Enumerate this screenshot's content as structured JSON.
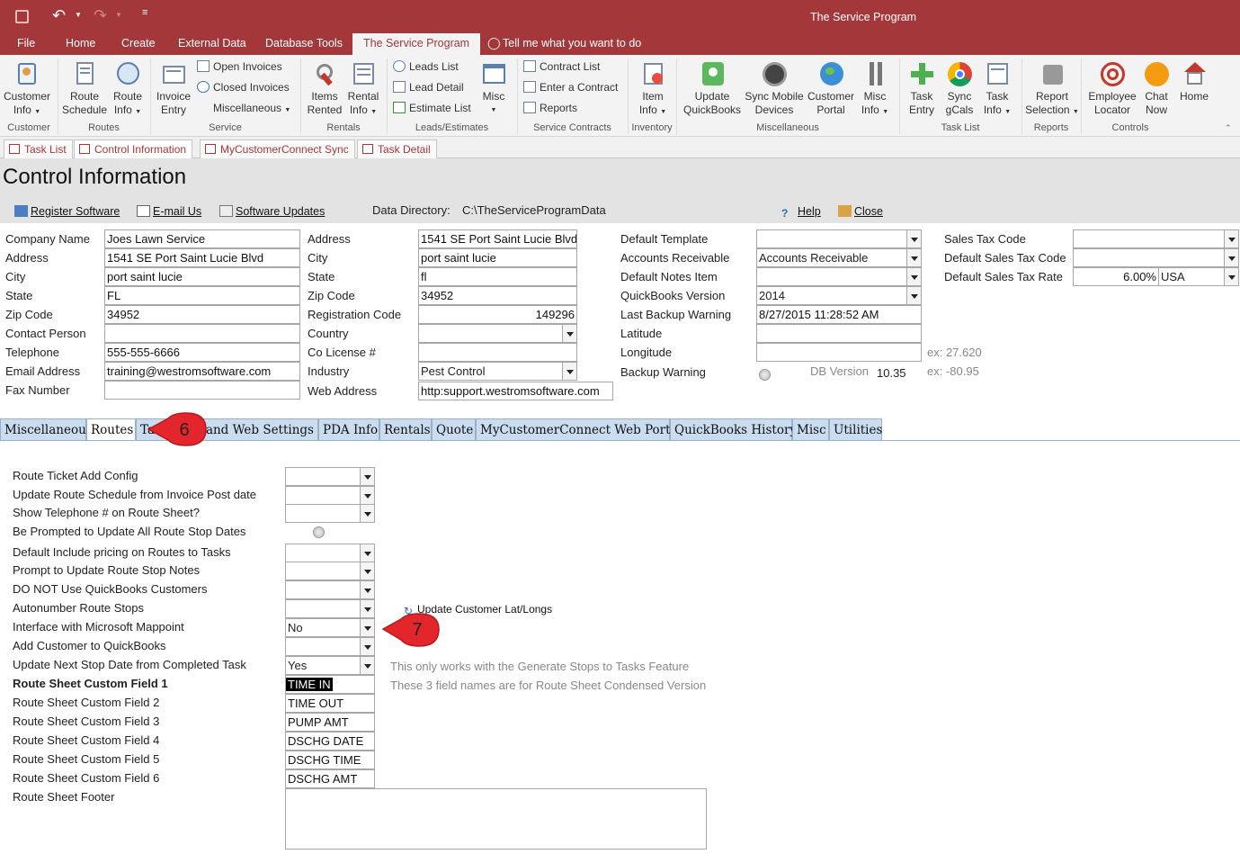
{
  "app": {
    "title": "The Service Program"
  },
  "menu": {
    "file": "File",
    "home": "Home",
    "create": "Create",
    "external": "External Data",
    "dbtools": "Database Tools",
    "service": "The Service Program",
    "tell": "Tell me what you want to do"
  },
  "ribbon": {
    "customer_info": "Customer",
    "customer_info2": "Info",
    "route_schedule": "Route",
    "route_schedule2": "Schedule",
    "route_info": "Route",
    "route_info2": "Info",
    "invoice_entry": "Invoice",
    "invoice_entry2": "Entry",
    "open_invoices": "Open Invoices",
    "closed_invoices": "Closed Invoices",
    "miscellaneous": "Miscellaneous",
    "items_rented": "Items",
    "items_rented2": "Rented",
    "rental_info": "Rental",
    "rental_info2": "Info",
    "leads_list": "Leads List",
    "lead_detail": "Lead Detail",
    "estimate_list": "Estimate List",
    "misc": "Misc",
    "contract_list": "Contract List",
    "enter_contract": "Enter a Contract",
    "reports": "Reports",
    "item_info": "Item",
    "item_info2": "Info",
    "update_qb": "Update",
    "update_qb2": "QuickBooks",
    "sync_mobile": "Sync Mobile",
    "sync_mobile2": "Devices",
    "customer_portal": "Customer",
    "customer_portal2": "Portal",
    "misc_info": "Misc",
    "misc_info2": "Info",
    "task_entry": "Task",
    "task_entry2": "Entry",
    "sync_gcals": "Sync",
    "sync_gcals2": "gCals",
    "task_info": "Task",
    "task_info2": "Info",
    "report_selection": "Report",
    "report_selection2": "Selection",
    "employee_locator": "Employee",
    "employee_locator2": "Locator",
    "chat_now": "Chat",
    "chat_now2": "Now",
    "home": "Home",
    "groups": {
      "customer": "Customer",
      "routes": "Routes",
      "service": "Service",
      "rentals": "Rentals",
      "leads": "Leads/Estimates",
      "contracts": "Service Contracts",
      "inventory": "Inventory",
      "miscellaneous": "Miscellaneous",
      "tasklist": "Task List",
      "reports": "Reports",
      "controls": "Controls"
    }
  },
  "doc_tabs": [
    "Task List",
    "Control Information",
    "MyCustomerConnect Sync",
    "Task Detail"
  ],
  "header": {
    "title": "Control Information",
    "register": "Register Software",
    "email": "E-mail Us",
    "updates": "Software Updates",
    "data_dir_label": "Data Directory:",
    "data_dir": "C:\\TheServiceProgramData",
    "help": "Help",
    "close": "Close"
  },
  "company": {
    "labels": [
      "Company Name",
      "Address",
      "City",
      "State",
      "Zip Code",
      "Contact Person",
      "Telephone",
      "Email Address",
      "Fax Number"
    ],
    "values": [
      "Joes Lawn Service",
      "1541 SE Port Saint Lucie Blvd",
      "port saint lucie",
      "FL",
      "34952",
      "",
      "555-555-6666",
      "training@westromsoftware.com",
      ""
    ]
  },
  "registration": {
    "labels": [
      "Address",
      "City",
      "State",
      "Zip Code",
      "Registration Code",
      "Country",
      "Co License #",
      "Industry",
      "Web Address"
    ],
    "address": "1541 SE Port Saint Lucie Blvd",
    "city": "port saint lucie",
    "state": "fl",
    "zip": "34952",
    "reg_code": "149296",
    "country": "",
    "license": "",
    "industry": "Pest Control",
    "web": "http:support.westromsoftware.com"
  },
  "defaults": {
    "labels": [
      "Default Template",
      "Accounts Receivable",
      "Default Notes Item",
      "QuickBooks Version",
      "Last Backup Warning",
      "Latitude",
      "Longitude",
      "Backup Warning"
    ],
    "template": "",
    "ar": "Accounts Receivable",
    "notes_item": "",
    "qb_version": "2014",
    "last_backup": "8/27/2015 11:28:52 AM",
    "latitude": "",
    "longitude": "",
    "lat_hint": "ex: 27.620",
    "lon_hint": "ex: -80.95",
    "db_version_label": "DB Version",
    "db_version": "10.35"
  },
  "tax": {
    "labels": [
      "Sales Tax Code",
      "Default Sales Tax Code",
      "Default Sales Tax Rate"
    ],
    "code": "",
    "default_code": "",
    "rate": "6.00%",
    "country": "USA"
  },
  "tabs": [
    "Miscellaneous",
    "Routes",
    "Ta",
    "il and Web Settings",
    "PDA Info",
    "Rentals",
    "Quote",
    "MyCustomerConnect Web Portal",
    "QuickBooks History",
    "Misc",
    "Utilities"
  ],
  "callouts": {
    "c6": "6",
    "c7": "7"
  },
  "routes": {
    "labels": [
      "Route Ticket Add Config",
      "Update Route Schedule from Invoice Post date",
      "Show Telephone # on Route Sheet?",
      "Be Prompted to Update All Route Stop Dates",
      "Default Include pricing on Routes to Tasks",
      "Prompt to Update Route Stop Notes",
      "DO NOT Use QuickBooks Customers",
      "Autonumber Route Stops",
      "Interface with Microsoft Mappoint",
      "Add Customer to QuickBooks",
      "Update Next Stop Date from Completed Task",
      "Route Sheet Custom Field 1",
      "Route Sheet Custom Field 2",
      "Route Sheet Custom Field 3",
      "Route Sheet Custom Field 4",
      "Route Sheet Custom Field 5",
      "Route Sheet Custom Field 6",
      "Route Sheet Footer"
    ],
    "mappoint": "No",
    "next_stop": "Yes",
    "custom": [
      "TIME IN",
      "TIME OUT",
      "PUMP AMT",
      "DSCHG DATE",
      "DSCHG TIME",
      "DSCHG AMT"
    ],
    "footer": "",
    "update_latlong": "Update Customer Lat/Longs",
    "note1": "This only works with the Generate Stops to Tasks Feature",
    "note2": "These 3 field names are for Route Sheet Condensed Version"
  }
}
